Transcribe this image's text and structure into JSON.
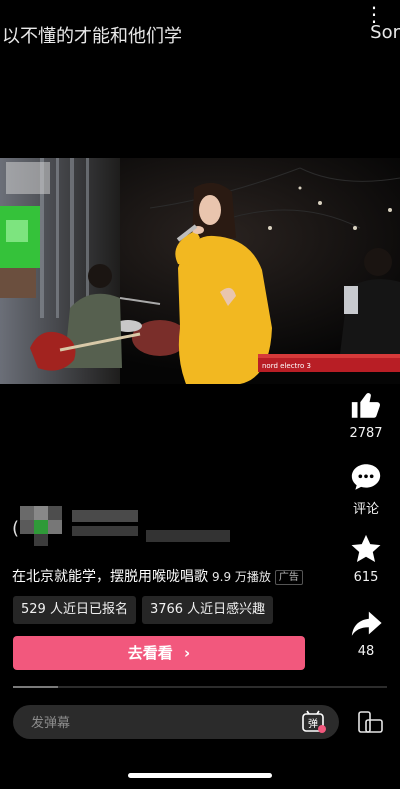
{
  "header": {
    "title": "以不懂的才能和他们学",
    "right_text": "Sor",
    "more_glyph": "⋮"
  },
  "video": {
    "stage_text": "nord electro 3"
  },
  "actions": {
    "like_count": "2787",
    "comment_label": "评论",
    "favorite_count": "615",
    "share_count": "48"
  },
  "ad": {
    "caption": "在北京就能学，摆脱用喉咙唱歌",
    "plays": "9.9 万播放",
    "ad_badge": "广告",
    "chips": [
      "529 人近日已报名",
      "3766 人近日感兴趣"
    ],
    "cta_label": "去看看",
    "cta_arrow": "›"
  },
  "playback": {
    "progress": 0.12
  },
  "danmu": {
    "placeholder": "发弹幕",
    "icon_label": "弹"
  },
  "colors": {
    "accent": "#f2587d",
    "chip_bg": "#262626",
    "input_bg": "#2b2b2b"
  }
}
